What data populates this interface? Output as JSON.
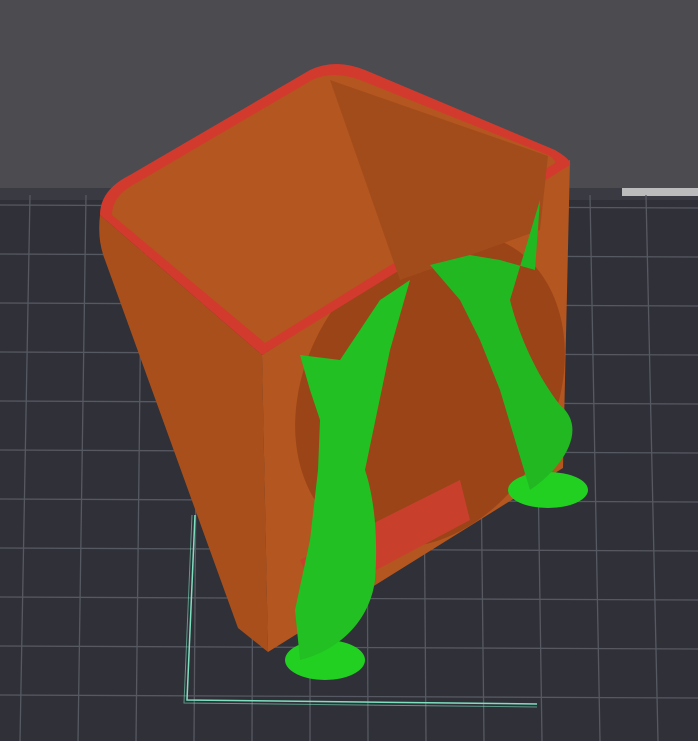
{
  "viewport": {
    "background_color": "#4b4b50",
    "bed_color": "#2f3038",
    "grid_color": "#54565f",
    "bed_outline_color": "#7fe0c0"
  },
  "model": {
    "wall_color": "#b4561f",
    "perimeter_color": "#d23a2e",
    "support_color": "#1fc41f"
  }
}
